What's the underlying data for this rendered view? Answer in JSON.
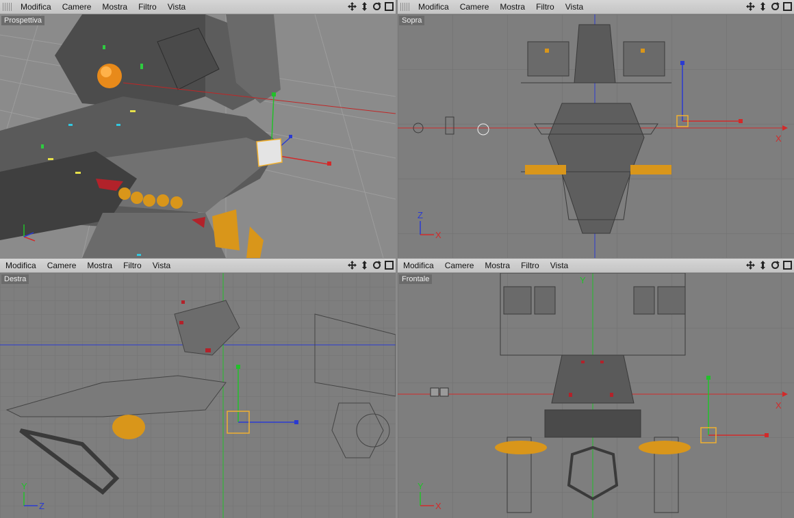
{
  "menu": {
    "items": [
      "Modifica",
      "Camere",
      "Mostra",
      "Filtro",
      "Vista"
    ]
  },
  "viewports": {
    "top_left": {
      "label": "Prospettiva"
    },
    "top_right": {
      "label": "Sopra"
    },
    "bottom_left": {
      "label": "Destra"
    },
    "bottom_right": {
      "label": "Frontale"
    }
  },
  "axis_labels": {
    "x": "X",
    "y": "Y",
    "z": "Z"
  },
  "icons": {
    "move": "move-view-icon",
    "zoom": "zoom-view-icon",
    "rotate": "rotate-view-icon",
    "maximize": "maximize-view-icon"
  },
  "colors": {
    "axis_x": "#d22a2a",
    "axis_y": "#22c02a",
    "axis_z": "#2a3ad2",
    "selection": "#f0b030",
    "model_orange": "#d9961a",
    "wire": "#3a3a3a",
    "grid": "#6f6f6f"
  }
}
